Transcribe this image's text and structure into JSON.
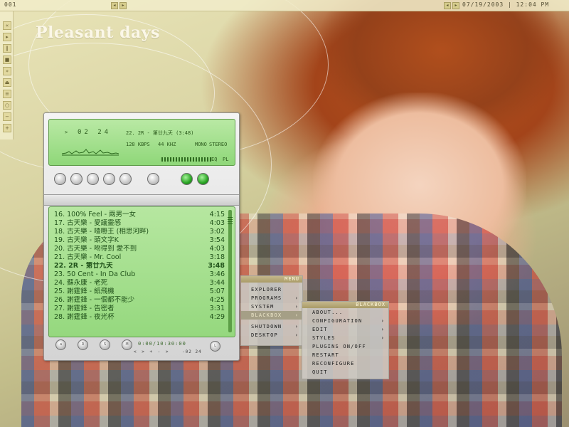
{
  "topbar": {
    "workspace": "001",
    "clock": "07/19/2003 | 12:04 PM",
    "prev_icon": "left-arrow",
    "next_icon": "right-arrow"
  },
  "wallpaper": {
    "title": "Pleasant days"
  },
  "player": {
    "lcd": {
      "play_state": ">",
      "time": "02 24",
      "track": "22. 2R - 第廿九天 (3:48)",
      "kbps": "128 KBPS",
      "khz": "44 KHZ",
      "mono": "MONO",
      "stereo": "STEREO",
      "eq": "EQ",
      "pl": "PL"
    },
    "playlist": [
      {
        "title": "16. 100% Feel - 兩男一女",
        "dur": "4:15"
      },
      {
        "title": "17. 古天樂 - 愛議靈感",
        "dur": "4:03"
      },
      {
        "title": "18. 古天樂 - 喳嘢王 (相思河畔)",
        "dur": "3:02"
      },
      {
        "title": "19. 古天樂 - 頭文字K",
        "dur": "3:54"
      },
      {
        "title": "20. 古天樂 - 吻得到 愛不到",
        "dur": "4:03"
      },
      {
        "title": "21. 古天樂 - Mr. Cool",
        "dur": "3:18"
      },
      {
        "title": "22. 2R - 第廿九天",
        "dur": "3:48"
      },
      {
        "title": "23. 50 Cent - In Da Club",
        "dur": "3:46"
      },
      {
        "title": "24. 蘇永康 - 老死",
        "dur": "3:44"
      },
      {
        "title": "25. 謝霆鋒 - 紙飛機",
        "dur": "5:07"
      },
      {
        "title": "26. 謝霆鋒 - 一個都不能少",
        "dur": "4:25"
      },
      {
        "title": "27. 謝霆鋒 - 告密者",
        "dur": "3:31"
      },
      {
        "title": "28. 謝霆鋒 - 夜光杯",
        "dur": "4:29"
      }
    ],
    "total_time": "0:00/10:30:00",
    "nav": "< > + - >",
    "elapsed": "-02 24",
    "bottom_buttons": [
      "a",
      "R",
      "S",
      "M"
    ],
    "close_label": "L"
  },
  "menu": {
    "title": "MENU",
    "items": [
      {
        "label": "EXPLORER",
        "arrow": ""
      },
      {
        "label": "PROGRAMS",
        "arrow": "›"
      },
      {
        "label": "SYSTEM",
        "arrow": "›"
      },
      {
        "label": "BLACKBOX",
        "arrow": "›"
      },
      {
        "label": "SHUTDOWN",
        "arrow": "›"
      },
      {
        "label": "DESKTOP",
        "arrow": "›"
      }
    ]
  },
  "submenu": {
    "title": "BLACKBOX",
    "items": [
      {
        "label": "ABOUT...",
        "arrow": ""
      },
      {
        "label": "CONFIGURATION",
        "arrow": "›"
      },
      {
        "label": "EDIT",
        "arrow": "›"
      },
      {
        "label": "STYLES",
        "arrow": "›"
      },
      {
        "label": "PLUGINS ON/OFF",
        "arrow": ""
      },
      {
        "label": "RESTART",
        "arrow": ""
      },
      {
        "label": "RECONFIGURE",
        "arrow": ""
      },
      {
        "label": "QUIT",
        "arrow": ""
      }
    ]
  }
}
